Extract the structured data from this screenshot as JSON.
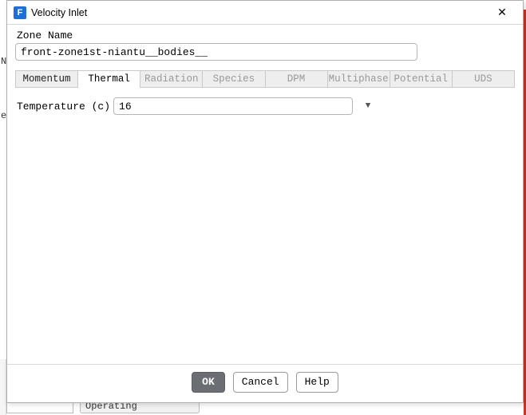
{
  "window": {
    "title": "Velocity Inlet",
    "icon_letter": "F",
    "close_glyph": "✕"
  },
  "zone": {
    "label": "Zone Name",
    "value": "front-zone1st-niantu__bodies__"
  },
  "tabs": [
    {
      "label": "Momentum",
      "active": false,
      "enabled": true
    },
    {
      "label": "Thermal",
      "active": true,
      "enabled": true
    },
    {
      "label": "Radiation",
      "active": false,
      "enabled": false
    },
    {
      "label": "Species",
      "active": false,
      "enabled": false
    },
    {
      "label": "DPM",
      "active": false,
      "enabled": false
    },
    {
      "label": "Multiphase",
      "active": false,
      "enabled": false
    },
    {
      "label": "Potential",
      "active": false,
      "enabled": false
    },
    {
      "label": "UDS",
      "active": false,
      "enabled": false
    }
  ],
  "thermal": {
    "temperature_label": "Temperature (c)",
    "temperature_value": "16",
    "dropdown_glyph": "▼"
  },
  "footer": {
    "ok": "OK",
    "cancel": "Cancel",
    "help": "Help"
  },
  "background": {
    "button_label": "Operating Conditions"
  }
}
